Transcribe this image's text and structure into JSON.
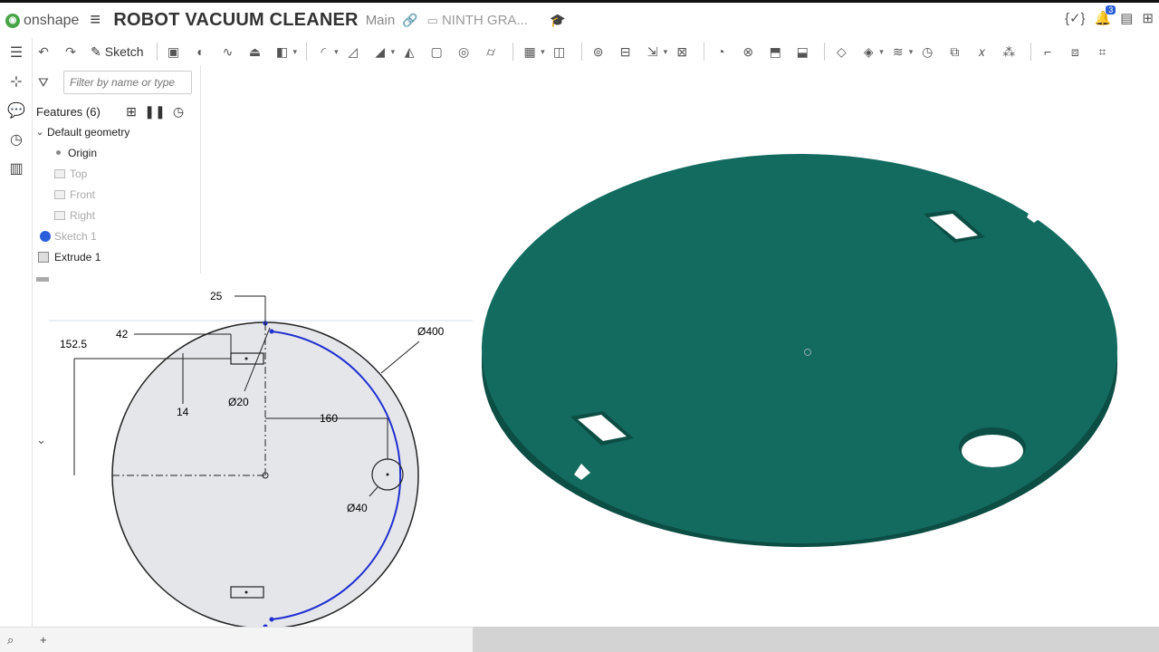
{
  "app": {
    "logo_text": "onshape",
    "doc_title": "ROBOT VACUUM CLEANER",
    "branch": "Main",
    "folder": "NINTH GRA..."
  },
  "top_right": {
    "variables_icon": "{✓}",
    "notification_count": "3"
  },
  "toolbar": {
    "sketch_label": "Sketch"
  },
  "feature_panel": {
    "filter_placeholder": "Filter by name or type",
    "features_label": "Features (6)",
    "tree": {
      "default_geometry": "Default geometry",
      "origin": "Origin",
      "top": "Top",
      "front": "Front",
      "right": "Right",
      "sketch": "Sketch 1",
      "extrude": "Extrude 1"
    }
  },
  "dimensions": {
    "d25": "25",
    "d42": "42",
    "d152": "152.5",
    "d14": "14",
    "d20": "Ø20",
    "d160": "160",
    "d400": "Ø400",
    "d40": "Ø40"
  },
  "colors": {
    "accent": "#2b5fd9",
    "part_top": "#136b60",
    "part_side": "#0c4d44",
    "sketch_fill": "#e4e6ea",
    "sketch_arc": "#1f2fd0"
  }
}
